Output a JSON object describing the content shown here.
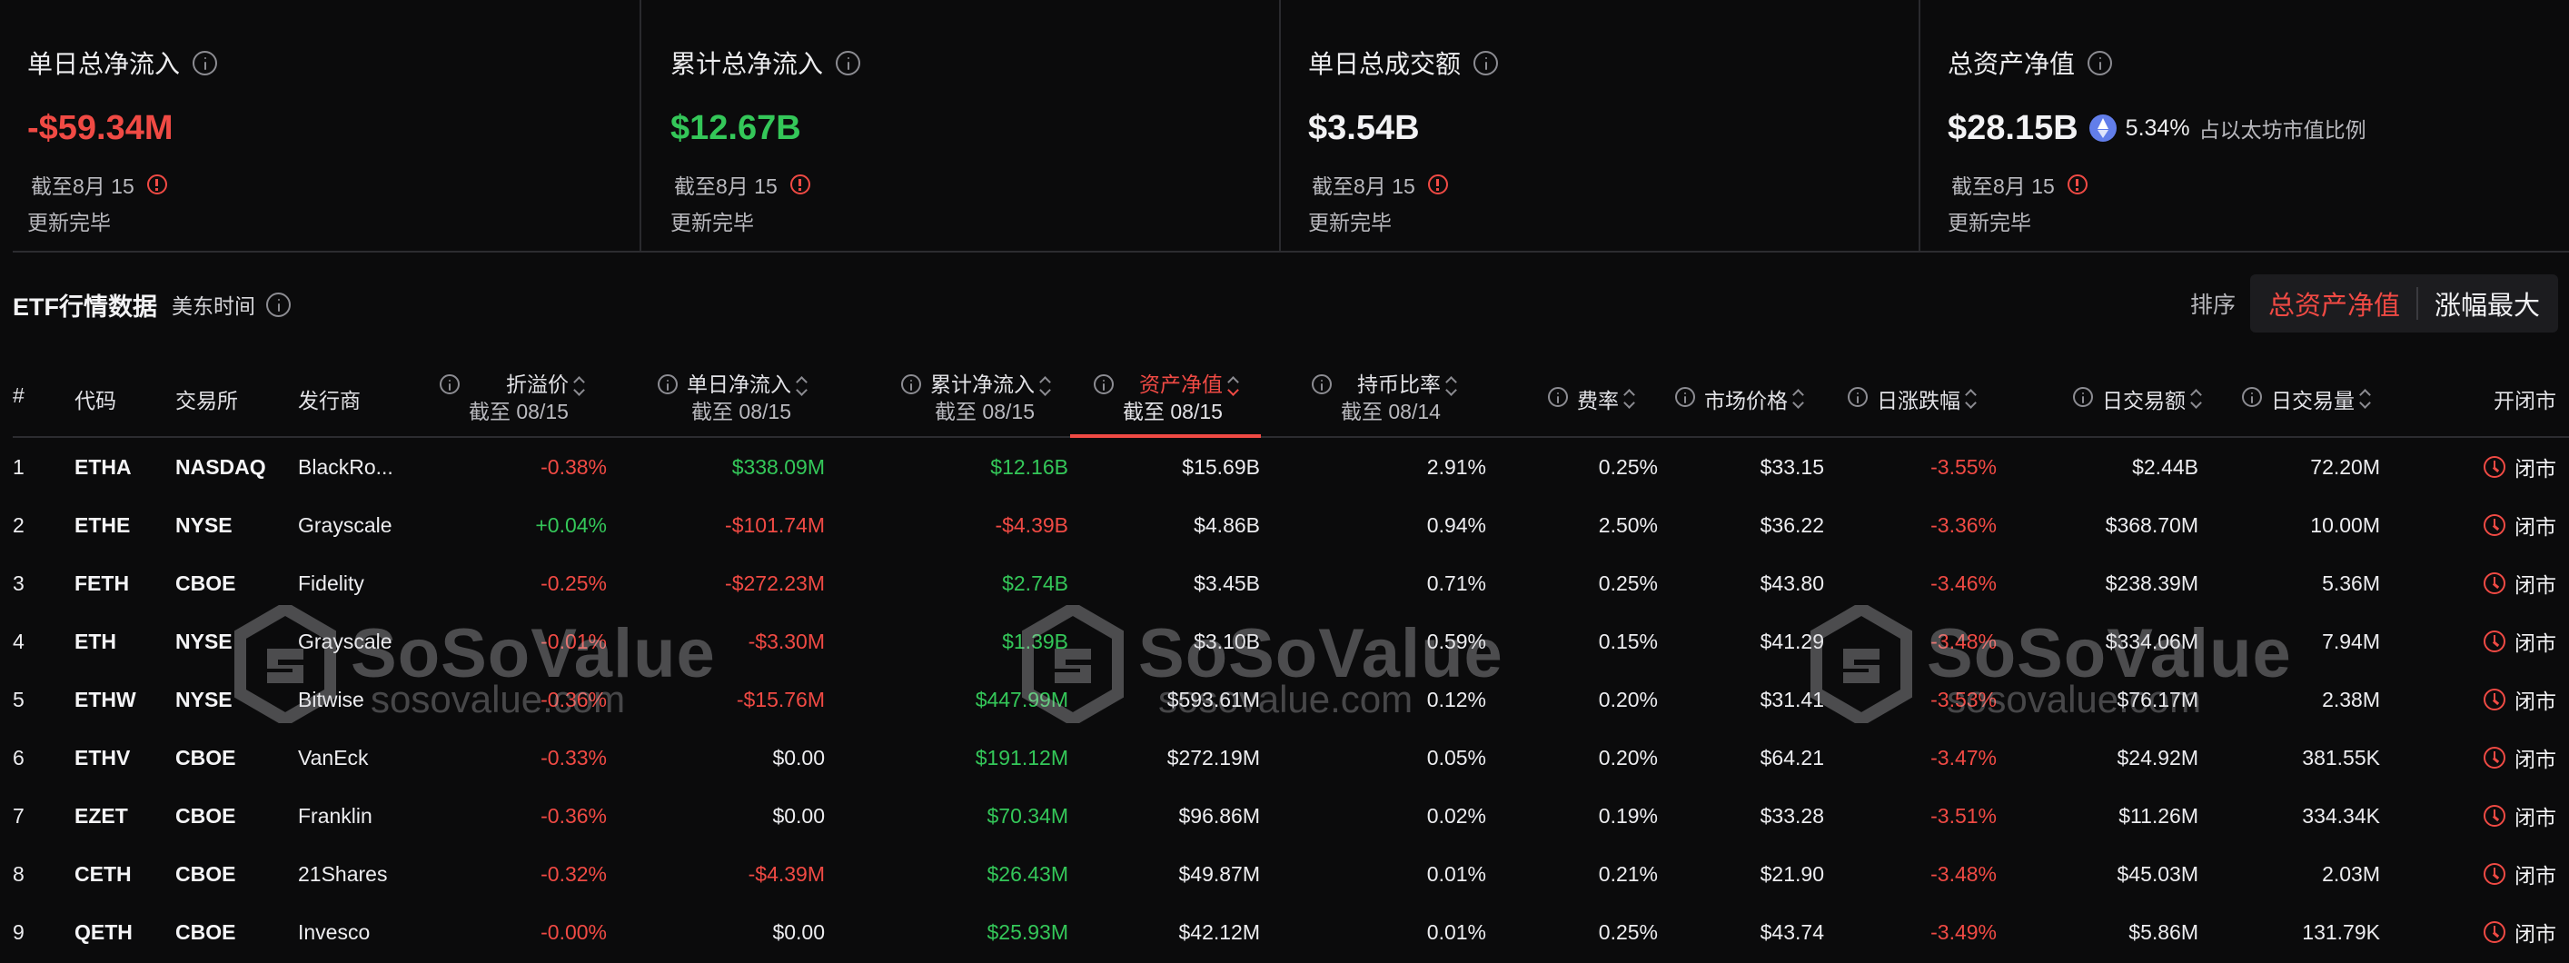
{
  "stats": [
    {
      "title": "单日总净流入",
      "value": "-$59.34M",
      "date": "截至8月 15",
      "status": "更新完毕"
    },
    {
      "title": "累计总净流入",
      "value": "$12.67B",
      "date": "截至8月 15",
      "status": "更新完毕"
    },
    {
      "title": "单日总成交额",
      "value": "$3.54B",
      "date": "截至8月 15",
      "status": "更新完毕"
    },
    {
      "title": "总资产净值",
      "value": "$28.15B",
      "pct": "5.34%",
      "pct_label": "占以太坊市值比例",
      "date": "截至8月 15",
      "status": "更新完毕"
    }
  ],
  "section": {
    "title": "ETF行情数据",
    "timezone": "美东时间"
  },
  "sort": {
    "label": "排序",
    "options": [
      "总资产净值",
      "涨幅最大"
    ],
    "active": "总资产净值"
  },
  "columns": {
    "idx": "#",
    "code": "代码",
    "exchange": "交易所",
    "issuer": "发行商",
    "premium": {
      "label": "折溢价",
      "sub": "截至 08/15"
    },
    "daily_inflow": {
      "label": "单日净流入",
      "sub": "截至 08/15"
    },
    "cum_inflow": {
      "label": "累计净流入",
      "sub": "截至 08/15"
    },
    "nav": {
      "label": "资产净值",
      "sub": "截至 08/15"
    },
    "holding_ratio": {
      "label": "持币比率",
      "sub": "截至 08/14"
    },
    "fee": "费率",
    "price": "市场价格",
    "change": "日涨跌幅",
    "volume_usd": "日交易额",
    "volume_shares": "日交易量",
    "status": "开闭市"
  },
  "rows": [
    {
      "idx": "1",
      "code": "ETHA",
      "exchange": "NASDAQ",
      "issuer": "BlackRo...",
      "premium": "-0.38%",
      "daily_inflow": "$338.09M",
      "cum_inflow": "$12.16B",
      "nav": "$15.69B",
      "holding_ratio": "2.91%",
      "fee": "0.25%",
      "price": "$33.15",
      "change": "-3.55%",
      "volume_usd": "$2.44B",
      "volume_shares": "72.20M",
      "status": "闭市"
    },
    {
      "idx": "2",
      "code": "ETHE",
      "exchange": "NYSE",
      "issuer": "Grayscale",
      "premium": "+0.04%",
      "daily_inflow": "-$101.74M",
      "cum_inflow": "-$4.39B",
      "nav": "$4.86B",
      "holding_ratio": "0.94%",
      "fee": "2.50%",
      "price": "$36.22",
      "change": "-3.36%",
      "volume_usd": "$368.70M",
      "volume_shares": "10.00M",
      "status": "闭市"
    },
    {
      "idx": "3",
      "code": "FETH",
      "exchange": "CBOE",
      "issuer": "Fidelity",
      "premium": "-0.25%",
      "daily_inflow": "-$272.23M",
      "cum_inflow": "$2.74B",
      "nav": "$3.45B",
      "holding_ratio": "0.71%",
      "fee": "0.25%",
      "price": "$43.80",
      "change": "-3.46%",
      "volume_usd": "$238.39M",
      "volume_shares": "5.36M",
      "status": "闭市"
    },
    {
      "idx": "4",
      "code": "ETH",
      "exchange": "NYSE",
      "issuer": "Grayscale",
      "premium": "-0.01%",
      "daily_inflow": "-$3.30M",
      "cum_inflow": "$1.39B",
      "nav": "$3.10B",
      "holding_ratio": "0.59%",
      "fee": "0.15%",
      "price": "$41.29",
      "change": "-3.48%",
      "volume_usd": "$334.06M",
      "volume_shares": "7.94M",
      "status": "闭市"
    },
    {
      "idx": "5",
      "code": "ETHW",
      "exchange": "NYSE",
      "issuer": "Bitwise",
      "premium": "-0.36%",
      "daily_inflow": "-$15.76M",
      "cum_inflow": "$447.99M",
      "nav": "$593.61M",
      "holding_ratio": "0.12%",
      "fee": "0.20%",
      "price": "$31.41",
      "change": "-3.53%",
      "volume_usd": "$76.17M",
      "volume_shares": "2.38M",
      "status": "闭市"
    },
    {
      "idx": "6",
      "code": "ETHV",
      "exchange": "CBOE",
      "issuer": "VanEck",
      "premium": "-0.33%",
      "daily_inflow": "$0.00",
      "cum_inflow": "$191.12M",
      "nav": "$272.19M",
      "holding_ratio": "0.05%",
      "fee": "0.20%",
      "price": "$64.21",
      "change": "-3.47%",
      "volume_usd": "$24.92M",
      "volume_shares": "381.55K",
      "status": "闭市"
    },
    {
      "idx": "7",
      "code": "EZET",
      "exchange": "CBOE",
      "issuer": "Franklin",
      "premium": "-0.36%",
      "daily_inflow": "$0.00",
      "cum_inflow": "$70.34M",
      "nav": "$96.86M",
      "holding_ratio": "0.02%",
      "fee": "0.19%",
      "price": "$33.28",
      "change": "-3.51%",
      "volume_usd": "$11.26M",
      "volume_shares": "334.34K",
      "status": "闭市"
    },
    {
      "idx": "8",
      "code": "CETH",
      "exchange": "CBOE",
      "issuer": "21Shares",
      "premium": "-0.32%",
      "daily_inflow": "-$4.39M",
      "cum_inflow": "$26.43M",
      "nav": "$49.87M",
      "holding_ratio": "0.01%",
      "fee": "0.21%",
      "price": "$21.90",
      "change": "-3.48%",
      "volume_usd": "$45.03M",
      "volume_shares": "2.03M",
      "status": "闭市"
    },
    {
      "idx": "9",
      "code": "QETH",
      "exchange": "CBOE",
      "issuer": "Invesco",
      "premium": "-0.00%",
      "daily_inflow": "$0.00",
      "cum_inflow": "$25.93M",
      "nav": "$42.12M",
      "holding_ratio": "0.01%",
      "fee": "0.25%",
      "price": "$43.74",
      "change": "-3.49%",
      "volume_usd": "$5.86M",
      "volume_shares": "131.79K",
      "status": "闭市"
    }
  ],
  "watermark": {
    "brand": "SoSoValue",
    "url": "sosovalue.com"
  },
  "colors": {
    "negative": "#f04a44",
    "positive": "#34c759",
    "accent": "#f04a44",
    "background": "#0b0b0c"
  }
}
